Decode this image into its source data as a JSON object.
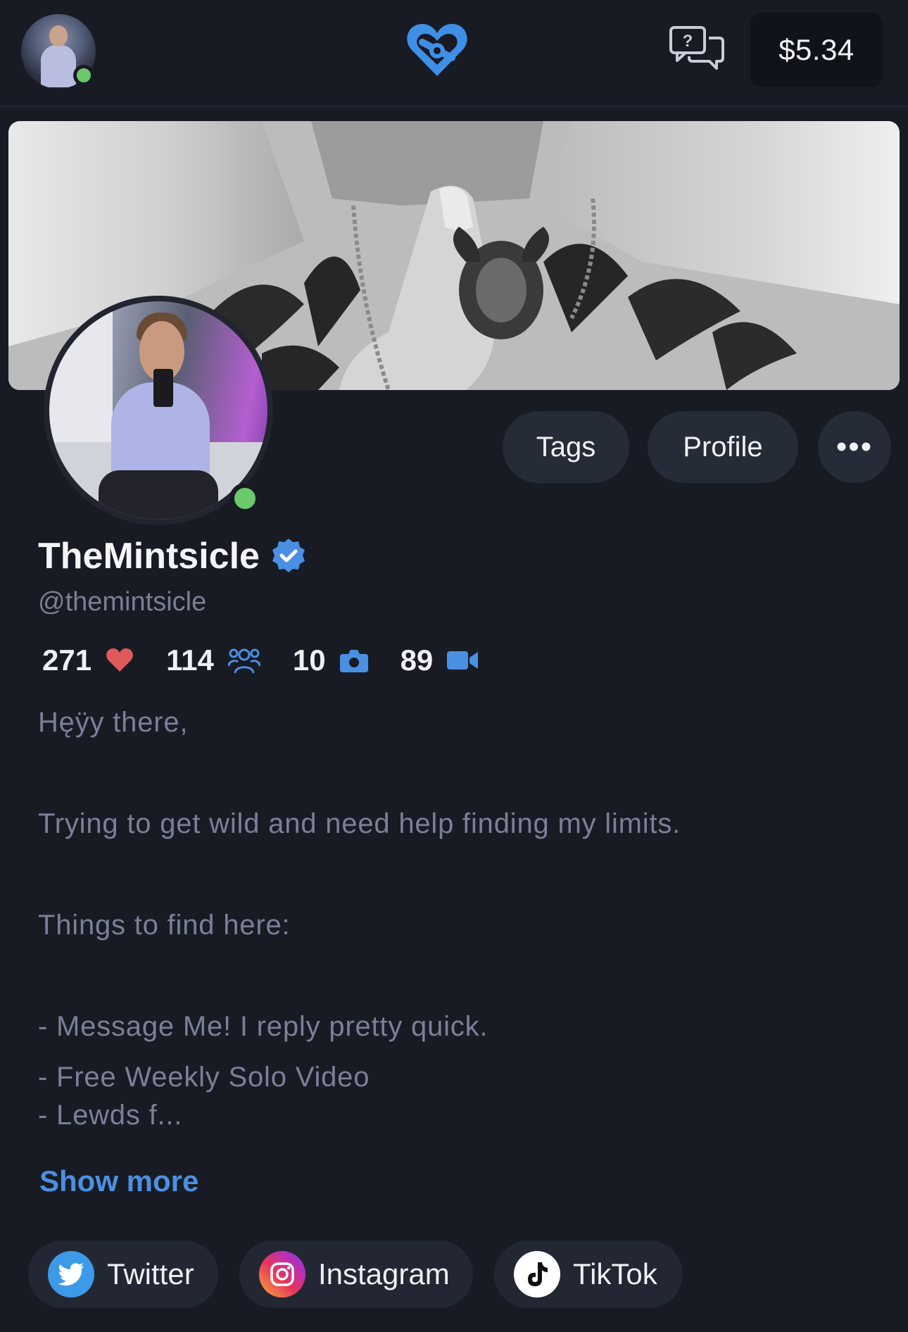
{
  "header": {
    "balance": "$5.34",
    "icons": {
      "avatar": "user-avatar",
      "logo": "brand-logo-heart",
      "messages": "chat-question-icon"
    },
    "accent_color": "#4a90e2"
  },
  "profile": {
    "display_name": "TheMintsicle",
    "handle": "@themintsicle",
    "verified": true,
    "online": true
  },
  "actions": {
    "tags_label": "Tags",
    "profile_label": "Profile",
    "more_label": "•••"
  },
  "stats": [
    {
      "value": "271",
      "icon": "heart-icon",
      "color": "#e05a5a"
    },
    {
      "value": "114",
      "icon": "users-icon",
      "color": "#4a90e2"
    },
    {
      "value": "10",
      "icon": "camera-icon",
      "color": "#4a90e2"
    },
    {
      "value": "89",
      "icon": "video-icon",
      "color": "#4a90e2"
    }
  ],
  "bio": {
    "lines": [
      "Hęÿy there,",
      "Trying to get wild and need help finding my limits.",
      "Things to find here:",
      "- Message Me! I reply pretty quick.",
      "- Free Weekly Solo Video",
      "- Lewds f..."
    ],
    "show_more": "Show more"
  },
  "social": [
    {
      "label": "Twitter",
      "icon": "twitter-icon",
      "color": "#3d9ae8"
    },
    {
      "label": "Instagram",
      "icon": "instagram-icon"
    },
    {
      "label": "TikTok",
      "icon": "tiktok-icon"
    }
  ]
}
